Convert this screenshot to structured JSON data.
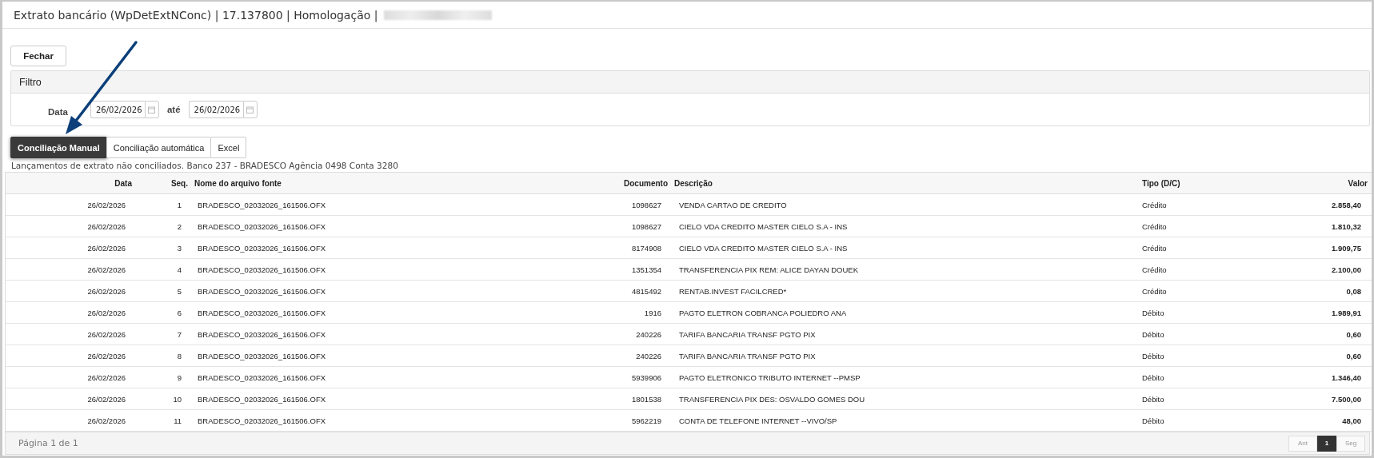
{
  "window": {
    "title": "Extrato bancário (WpDetExtNConc) | 17.137800 | Homologação |"
  },
  "close_button": "Fechar",
  "filter": {
    "title": "Filtro",
    "date_label": "Data",
    "date_from": "26/02/2026",
    "between_label": "até",
    "date_to": "26/02/2026"
  },
  "tabs": [
    {
      "label": "Conciliação Manual",
      "selected": true
    },
    {
      "label": "Conciliação automática",
      "selected": false
    },
    {
      "label": "Excel",
      "selected": false
    }
  ],
  "caption": "Lançamentos de extrato não conciliados. Banco 237 - BRADESCO Agência 0498 Conta 3280",
  "table": {
    "columns": [
      "Data",
      "Seq.",
      "Nome do arquivo fonte",
      "Documento",
      "Descrição",
      "Tipo (D/C)",
      "Valor"
    ],
    "rows": [
      [
        "26/02/2026",
        "1",
        "BRADESCO_02032026_161506.OFX",
        "1098627",
        "VENDA CARTAO DE CREDITO",
        "Crédito",
        "2.858,40"
      ],
      [
        "26/02/2026",
        "2",
        "BRADESCO_02032026_161506.OFX",
        "1098627",
        "CIELO VDA CREDITO MASTER CIELO S.A - INS",
        "Crédito",
        "1.810,32"
      ],
      [
        "26/02/2026",
        "3",
        "BRADESCO_02032026_161506.OFX",
        "8174908",
        "CIELO VDA CREDITO MASTER CIELO S.A - INS",
        "Crédito",
        "1.909,75"
      ],
      [
        "26/02/2026",
        "4",
        "BRADESCO_02032026_161506.OFX",
        "1351354",
        "TRANSFERENCIA PIX REM: ALICE DAYAN DOUEK",
        "Crédito",
        "2.100,00"
      ],
      [
        "26/02/2026",
        "5",
        "BRADESCO_02032026_161506.OFX",
        "4815492",
        "RENTAB.INVEST FACILCRED*",
        "Crédito",
        "0,08"
      ],
      [
        "26/02/2026",
        "6",
        "BRADESCO_02032026_161506.OFX",
        "1916",
        "PAGTO ELETRON COBRANCA POLIEDRO ANA",
        "Débito",
        "1.989,91"
      ],
      [
        "26/02/2026",
        "7",
        "BRADESCO_02032026_161506.OFX",
        "240226",
        "TARIFA BANCARIA TRANSF PGTO PIX",
        "Débito",
        "0,60"
      ],
      [
        "26/02/2026",
        "8",
        "BRADESCO_02032026_161506.OFX",
        "240226",
        "TARIFA BANCARIA TRANSF PGTO PIX",
        "Débito",
        "0,60"
      ],
      [
        "26/02/2026",
        "9",
        "BRADESCO_02032026_161506.OFX",
        "5939906",
        "PAGTO ELETRONICO TRIBUTO INTERNET --PMSP",
        "Débito",
        "1.346,40"
      ],
      [
        "26/02/2026",
        "10",
        "BRADESCO_02032026_161506.OFX",
        "1801538",
        "TRANSFERENCIA PIX DES: OSVALDO GOMES DOU",
        "Débito",
        "7.500,00"
      ],
      [
        "26/02/2026",
        "11",
        "BRADESCO_02032026_161506.OFX",
        "5962219",
        "CONTA DE TELEFONE INTERNET --VIVO/SP",
        "Débito",
        "48,00"
      ]
    ]
  },
  "pager": {
    "info": "Página 1 de 1",
    "prev": "Ant",
    "pages": [
      {
        "label": "1",
        "selected": true
      }
    ],
    "next": "Seg"
  }
}
